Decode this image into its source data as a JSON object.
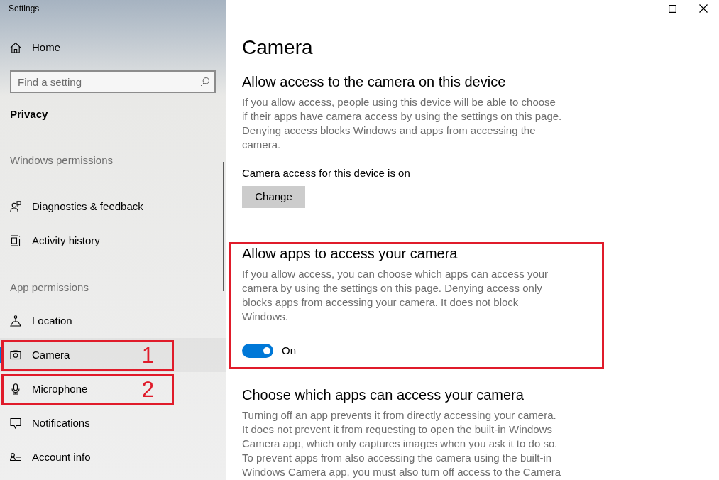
{
  "window": {
    "title": "Settings"
  },
  "sidebar": {
    "home": "Home",
    "search": {
      "placeholder": "Find a setting"
    },
    "heading": "Privacy",
    "groups": [
      {
        "title": "Windows permissions",
        "items": [
          {
            "label": "Diagnostics & feedback",
            "selected": false
          },
          {
            "label": "Activity history",
            "selected": false
          }
        ]
      },
      {
        "title": "App permissions",
        "items": [
          {
            "label": "Location",
            "selected": false
          },
          {
            "label": "Camera",
            "selected": true,
            "annotation": "1"
          },
          {
            "label": "Microphone",
            "selected": false,
            "annotation": "2"
          },
          {
            "label": "Notifications",
            "selected": false
          },
          {
            "label": "Account info",
            "selected": false
          }
        ]
      }
    ]
  },
  "content": {
    "title": "Camera",
    "sections": [
      {
        "heading": "Allow access to the camera on this device",
        "description": "If you allow access, people using this device will be able to choose if their apps have camera access by using the settings on this page. Denying access blocks Windows and apps from accessing the camera.",
        "status": "Camera access for this device is on",
        "button": "Change",
        "outlined": false
      },
      {
        "heading": "Allow apps to access your camera",
        "description": "If you allow access, you can choose which apps can access your camera by using the settings on this page. Denying access only blocks apps from accessing your camera. It does not block Windows.",
        "toggle": {
          "on": true,
          "label": "On"
        },
        "outlined": true
      },
      {
        "heading": "Choose which apps can access your camera",
        "description": "Turning off an app prevents it from directly accessing your camera. It does not prevent it from requesting to open the built-in Windows Camera app, which only captures images when you ask it to do so. To prevent apps from also accessing the camera using the built-in Windows Camera app, you must also turn off access to the Camera",
        "outlined": false
      }
    ]
  }
}
